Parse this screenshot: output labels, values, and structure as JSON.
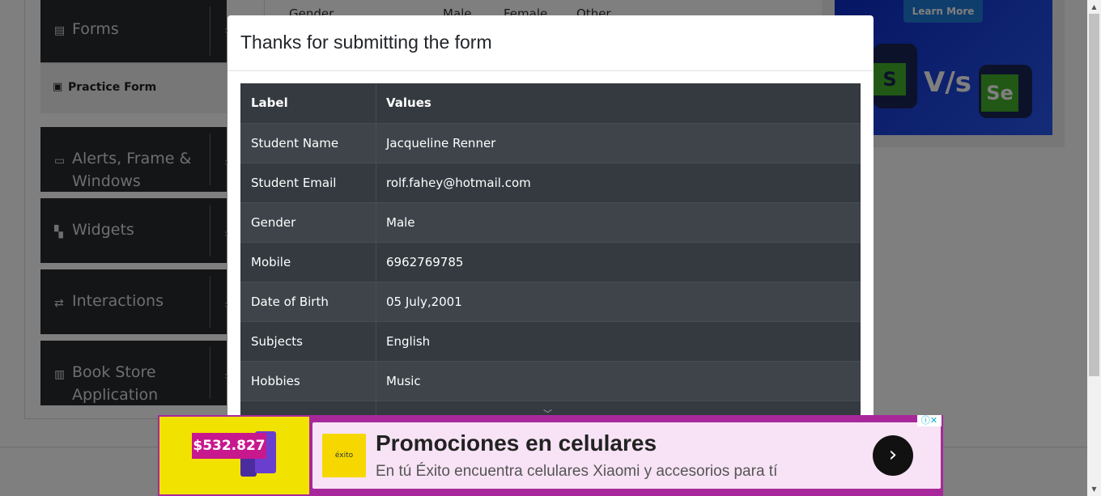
{
  "sidebar": {
    "groups": [
      {
        "label": "Forms",
        "icon": "document-icon"
      },
      {
        "label": "Alerts, Frame &",
        "label2": "Windows",
        "icon": "window-icon"
      },
      {
        "label": "Widgets",
        "icon": "widgets-icon"
      },
      {
        "label": "Interactions",
        "icon": "interactions-icon"
      },
      {
        "label": "Book Store",
        "label2": "Application",
        "icon": "books-icon"
      }
    ],
    "active_item": "Practice Form"
  },
  "form_bg": {
    "gender_label": "Gender",
    "opt1": "Male",
    "opt2": "Female",
    "opt3": "Other"
  },
  "side_ad": {
    "button": "Learn More",
    "vs": "V/s",
    "se": "Se",
    "s": "S"
  },
  "modal": {
    "title": "Thanks for submitting the form",
    "headers": [
      "Label",
      "Values"
    ],
    "rows": [
      [
        "Student Name",
        "Jacqueline Renner"
      ],
      [
        "Student Email",
        "rolf.fahey@hotmail.com"
      ],
      [
        "Gender",
        "Male"
      ],
      [
        "Mobile",
        "6962769785"
      ],
      [
        "Date of Birth",
        "05 July,2001"
      ],
      [
        "Subjects",
        "English"
      ],
      [
        "Hobbies",
        "Music"
      ]
    ]
  },
  "bottom_ad": {
    "price": "$532.827",
    "title": "Promociones en celulares",
    "desc": "En tú Éxito encuentra celulares Xiaomi y accesorios para tí",
    "logo_text": "éxito",
    "choice": "ⓘ✕"
  },
  "colors": {
    "table_bg": "#343a40",
    "table_odd": "#3e444a",
    "ad_bg": "#a8289b"
  }
}
